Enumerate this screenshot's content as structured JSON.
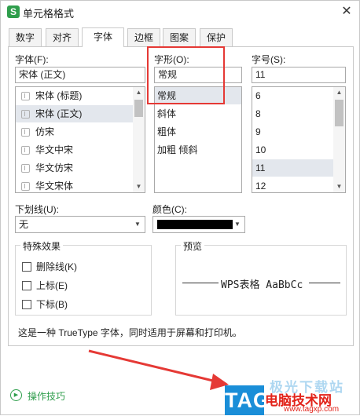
{
  "window": {
    "title": "单元格格式",
    "app_badge": "S",
    "close_glyph": "✕"
  },
  "tabs": [
    {
      "label": "数字",
      "active": false
    },
    {
      "label": "对齐",
      "active": false
    },
    {
      "label": "字体",
      "active": true
    },
    {
      "label": "边框",
      "active": false
    },
    {
      "label": "图案",
      "active": false
    },
    {
      "label": "保护",
      "active": false
    }
  ],
  "font": {
    "label": "字体(F):",
    "value": "宋体 (正文)",
    "items": [
      "宋体 (标题)",
      "宋体 (正文)",
      "仿宋",
      "华文中宋",
      "华文仿宋",
      "华文宋体"
    ],
    "selected_index": 1
  },
  "style": {
    "label": "字形(O):",
    "value": "常规",
    "items": [
      "常规",
      "斜体",
      "粗体",
      "加粗 倾斜"
    ],
    "selected_index": 0
  },
  "size": {
    "label": "字号(S):",
    "value": "11",
    "items": [
      "6",
      "8",
      "9",
      "10",
      "11",
      "12"
    ],
    "selected_index": 4
  },
  "underline": {
    "label": "下划线(U):",
    "value": "无"
  },
  "color": {
    "label": "颜色(C):",
    "value": "#000000"
  },
  "effects": {
    "title": "特殊效果",
    "strikethrough": "删除线(K)",
    "superscript": "上标(E)",
    "subscript": "下标(B)"
  },
  "preview": {
    "title": "预览",
    "sample": "WPS表格  AaBbCc"
  },
  "description": "这是一种 TrueType 字体，同时适用于屏幕和打印机。",
  "footer": {
    "tips": "操作技巧"
  },
  "watermark": {
    "tag": "TAG",
    "line1": "极光下载站",
    "line2": "电脑技术网",
    "url": "www.tagxp.com"
  },
  "colors": {
    "accent": "#2f9e4c",
    "highlight": "#e53935",
    "arrow": "#e53935",
    "watermark_blue": "#1a8ed8"
  }
}
